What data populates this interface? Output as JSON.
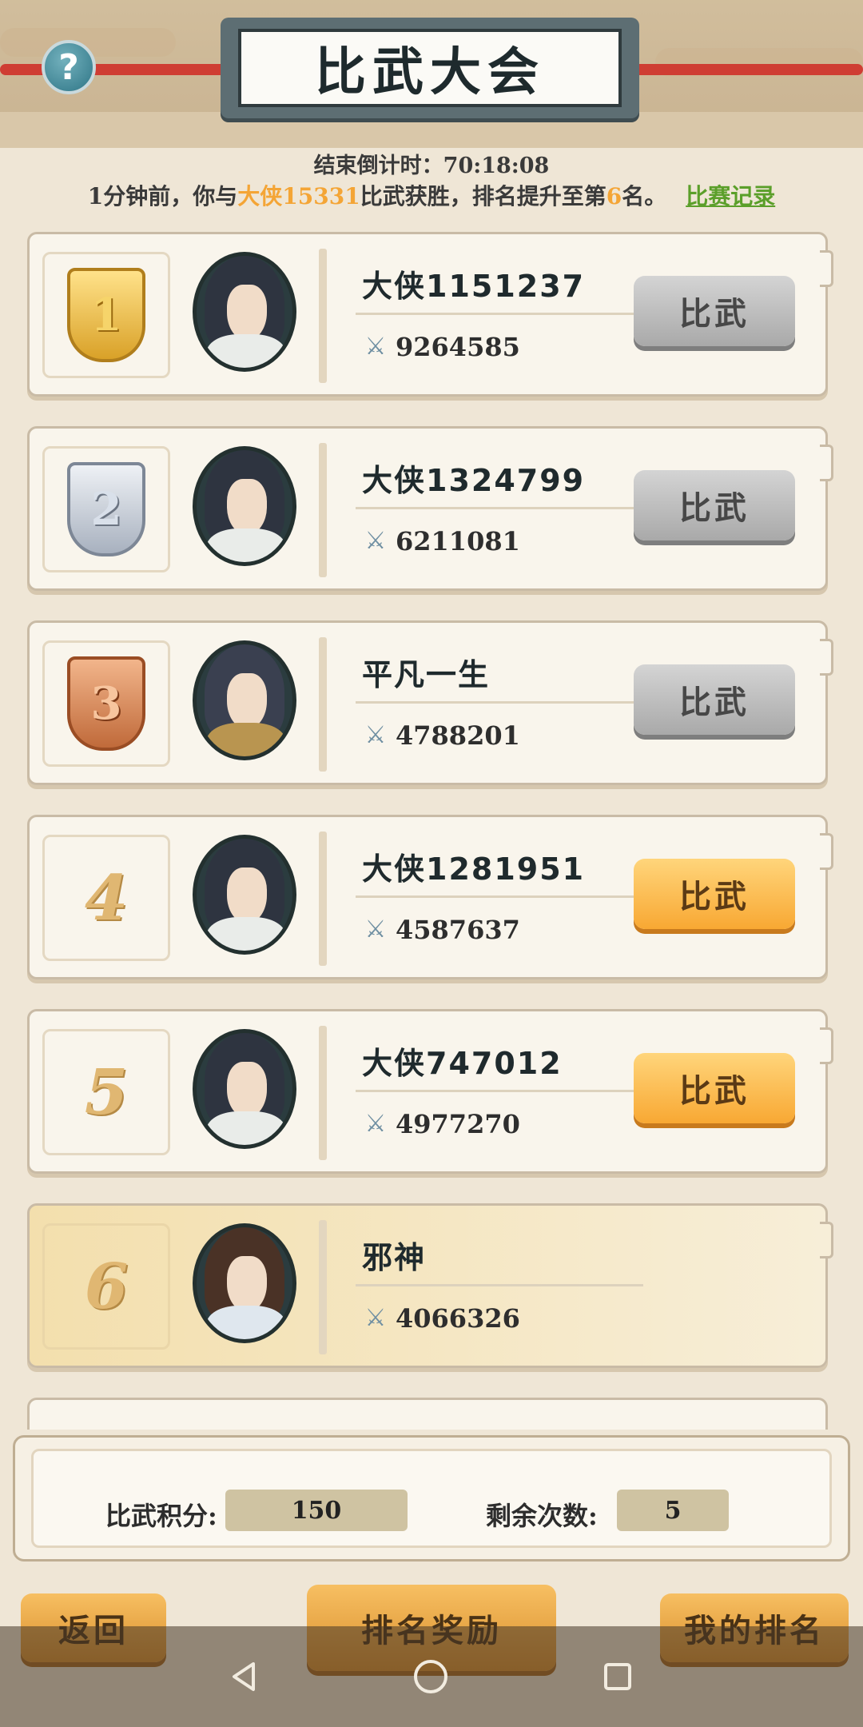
{
  "title": "比武大会",
  "help_icon": "?",
  "countdown": "结束倒计时：70:18:08",
  "notice": {
    "prefix": "1分钟前，你与",
    "opponent": "大侠15331",
    "middle": "比武获胜，排名提升至第",
    "rank": "6",
    "suffix": "名。",
    "record_link": "比赛记录"
  },
  "players": [
    {
      "rank": "1",
      "name": "大侠1151237",
      "power": "9264585",
      "button": "比武",
      "medal": "gold"
    },
    {
      "rank": "2",
      "name": "大侠1324799",
      "power": "6211081",
      "button": "比武",
      "medal": "silver"
    },
    {
      "rank": "3",
      "name": "平凡一生",
      "power": "4788201",
      "button": "比武",
      "medal": "bronze"
    },
    {
      "rank": "4",
      "name": "大侠1281951",
      "power": "4587637",
      "button": "比武"
    },
    {
      "rank": "5",
      "name": "大侠747012",
      "power": "4977270",
      "button": "比武"
    },
    {
      "rank": "6",
      "name": "邪神",
      "power": "4066326"
    }
  ],
  "stats": {
    "score_label": "比武积分:",
    "score_value": "150",
    "remaining_label": "剩余次数:",
    "remaining_value": "5"
  },
  "bottom": {
    "back": "返回",
    "rank_reward": "排名奖励",
    "my_rank": "我的排名"
  },
  "colors": {
    "highlight": "#f4a536",
    "link": "#5b9f2a",
    "button_gray": "#bdbdbd",
    "button_orange": "#f8a833"
  }
}
